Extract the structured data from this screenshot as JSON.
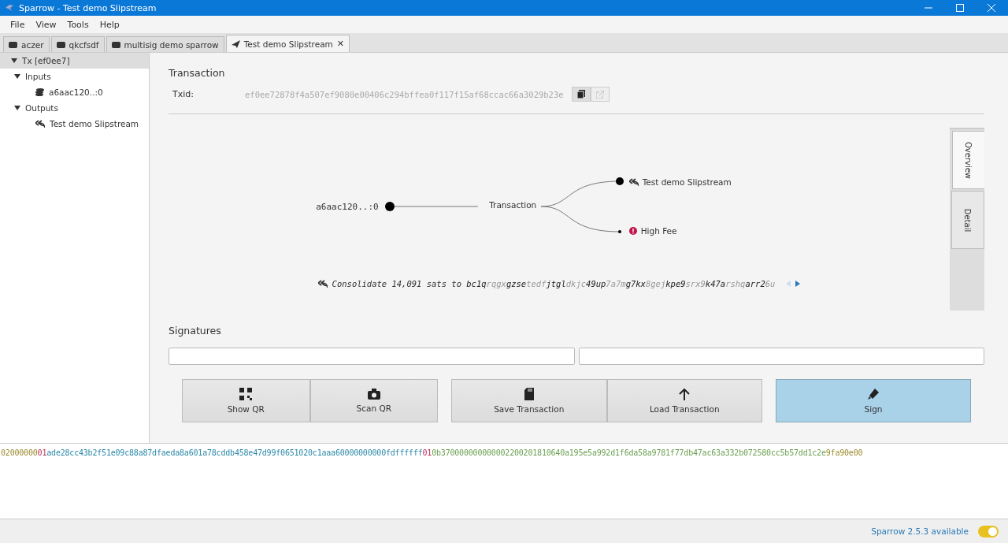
{
  "window": {
    "title": "Sparrow - Test demo Slipstream"
  },
  "menu": [
    "File",
    "View",
    "Tools",
    "Help"
  ],
  "tabs": [
    {
      "label": "aczer",
      "kind": "wallet",
      "selected": false
    },
    {
      "label": "qkcfsdf",
      "kind": "wallet",
      "selected": false
    },
    {
      "label": "multisig demo sparrow",
      "kind": "wallet",
      "selected": false
    },
    {
      "label": "Test demo Slipstream",
      "kind": "tx",
      "selected": true,
      "close": "✕"
    }
  ],
  "tree": [
    {
      "label": "Tx [ef0ee7]",
      "selected": true,
      "expanded": true,
      "children": [
        {
          "label": "Inputs",
          "expanded": true,
          "children": [
            {
              "label": "a6aac120..:0",
              "kind": "input",
              "selected": false
            }
          ],
          "selected": false
        },
        {
          "label": "Outputs",
          "expanded": true,
          "children": [
            {
              "label": "Test demo Slipstream",
              "kind": "output",
              "selected": false
            }
          ],
          "selected": false
        }
      ]
    }
  ],
  "transaction": {
    "heading": "Transaction",
    "txid_label": "Txid:",
    "txid": "ef0ee72878f4a507ef9080e00406c294bffea0f117f15af68ccac66a3029b23e"
  },
  "diagram": {
    "input": "a6aac120..:0",
    "center": "Transaction",
    "outputs": [
      {
        "label": "Test demo Slipstream",
        "kind": "output"
      },
      {
        "label": "High Fee",
        "kind": "fee"
      }
    ]
  },
  "summary": {
    "text": "Consolidate 14,091 sats to",
    "address": [
      {
        "t": "bc1q",
        "dim": false
      },
      {
        "t": "rqgx",
        "dim": true
      },
      {
        "t": "gzse",
        "dim": false
      },
      {
        "t": "tedf",
        "dim": true
      },
      {
        "t": "jtgl",
        "dim": false
      },
      {
        "t": "dkjc",
        "dim": true
      },
      {
        "t": "49up",
        "dim": false
      },
      {
        "t": "7a7m",
        "dim": true
      },
      {
        "t": "g7kx",
        "dim": false
      },
      {
        "t": "8gej",
        "dim": true
      },
      {
        "t": "kpe9",
        "dim": false
      },
      {
        "t": "srx9",
        "dim": true
      },
      {
        "t": "k47a",
        "dim": false
      },
      {
        "t": "rshq",
        "dim": true
      },
      {
        "t": "arr2",
        "dim": false
      },
      {
        "t": "6u",
        "dim": true
      }
    ]
  },
  "side_tabs": [
    {
      "label": "Overview",
      "selected": true
    },
    {
      "label": "Detail",
      "selected": false
    }
  ],
  "signatures": {
    "heading": "Signatures"
  },
  "buttons": [
    {
      "label": "Show QR",
      "kind": "qr"
    },
    {
      "label": "Scan QR",
      "kind": "camera"
    },
    {
      "label": "Save Transaction",
      "kind": "save"
    },
    {
      "label": "Load Transaction",
      "kind": "load"
    },
    {
      "label": "Sign",
      "kind": "sign"
    }
  ],
  "hex": [
    {
      "t": "02000000",
      "color": "#9c8a2c"
    },
    {
      "t": "01",
      "color": "#c0305a"
    },
    {
      "t": "ade28cc43b2f51e09c88a87dfaeda8a601a78cddb458e47d99f0651020c1aaa60000000000fdffffff",
      "color": "#2b88a8"
    },
    {
      "t": "01",
      "color": "#c0305a"
    },
    {
      "t": "0b370000000000002200201810640a195e5a992d1f6da58a9781f77db47ac63a332b072580cc5b57dd1c2e",
      "color": "#6aa050"
    },
    {
      "t": "9fa90e00",
      "color": "#9c8a2c"
    }
  ],
  "status": {
    "text": "Sparrow 2.5.3 available",
    "toggle_on": true
  }
}
